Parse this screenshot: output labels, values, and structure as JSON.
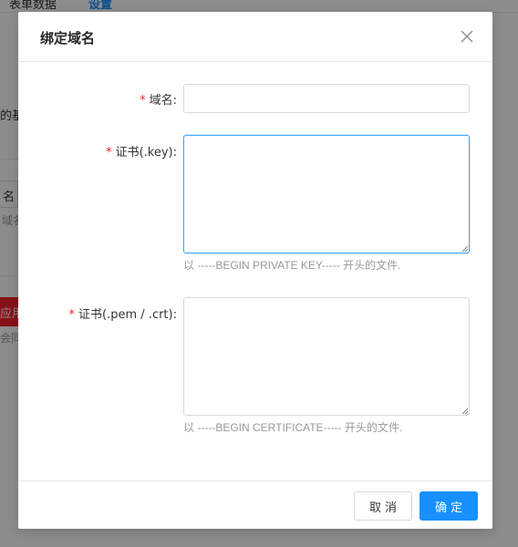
{
  "background": {
    "tabs": [
      "表单数据",
      "设置"
    ],
    "fragments": [
      "的基",
      "域名",
      "应用",
      "会同"
    ],
    "input_fragment": "名"
  },
  "modal": {
    "title": "绑定域名",
    "close_icon": "close-icon",
    "fields": [
      {
        "label": "域名",
        "colon": ":",
        "required": true,
        "value": "",
        "help": ""
      },
      {
        "label": "证书(.key)",
        "colon": ":",
        "required": true,
        "value": "",
        "help": "以 -----BEGIN PRIVATE KEY----- 开头的文件."
      },
      {
        "label": "证书(.pem / .crt)",
        "colon": ":",
        "required": true,
        "value": "",
        "help": "以 -----BEGIN CERTIFICATE----- 开头的文件."
      }
    ],
    "required_mark": "*",
    "cancel_label": "取消",
    "ok_label": "确定"
  },
  "colors": {
    "primary": "#1890ff",
    "required": "#f5222d",
    "mask": "rgba(0,0,0,0.45)"
  }
}
